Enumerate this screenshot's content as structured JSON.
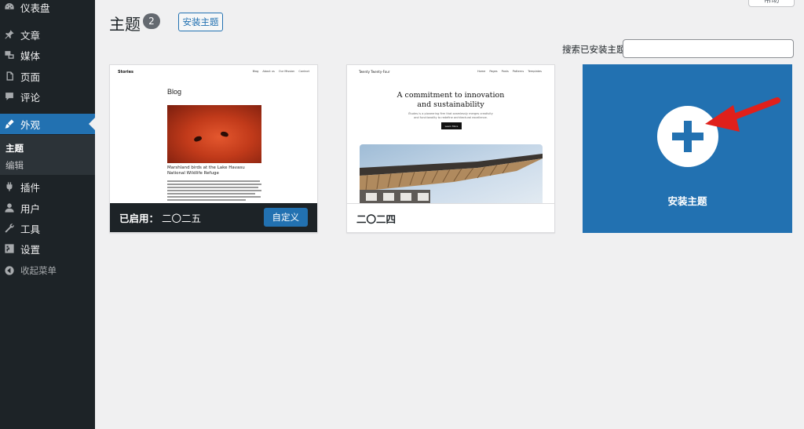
{
  "sidebar": {
    "items": [
      {
        "label": "仪表盘",
        "icon": "dashboard-icon"
      },
      {
        "label": "文章",
        "icon": "pin-icon"
      },
      {
        "label": "媒体",
        "icon": "media-icon"
      },
      {
        "label": "页面",
        "icon": "page-icon"
      },
      {
        "label": "评论",
        "icon": "comment-icon"
      },
      {
        "label": "外观",
        "icon": "brush-icon",
        "active": true
      },
      {
        "label": "插件",
        "icon": "plugin-icon"
      },
      {
        "label": "用户",
        "icon": "user-icon"
      },
      {
        "label": "工具",
        "icon": "wrench-icon"
      },
      {
        "label": "设置",
        "icon": "settings-icon"
      }
    ],
    "submenu": [
      {
        "label": "主题",
        "current": true
      },
      {
        "label": "编辑",
        "current": false
      }
    ],
    "collapse_label": "收起菜单"
  },
  "header": {
    "title": "主题",
    "count": "2",
    "add_new_label": "安装主题",
    "help_label": "帮助"
  },
  "search": {
    "label": "搜索已安装主题",
    "value": "",
    "placeholder": ""
  },
  "themes": [
    {
      "name": "二〇二五",
      "active_prefix": "已启用：",
      "active": true,
      "customize_label": "自定义",
      "preview": {
        "site_title": "Stories",
        "nav": [
          "Blog",
          "About us",
          "Our Mission",
          "Contact"
        ],
        "heading": "Blog",
        "post_title": "Marshland birds at the Lake Havasu National Wildlife Refuge"
      }
    },
    {
      "name": "二〇二四",
      "active": false,
      "preview": {
        "site_title": "Twenty Twenty-Four",
        "nav": [
          "Home",
          "Pages",
          "Posts",
          "Patterns",
          "Templates"
        ],
        "headline_1": "A commitment to innovation",
        "headline_2": "and sustainability",
        "sub_1": "Études is a pioneering firm that seamlessly merges creativity",
        "sub_2": "and functionality to redefine architectural excellence.",
        "button": "Learn More"
      }
    }
  ],
  "add_new_card": {
    "label": "安装主题"
  },
  "colors": {
    "admin_dark": "#1d2327",
    "accent": "#2271b1",
    "arrow": "#e0201b"
  }
}
